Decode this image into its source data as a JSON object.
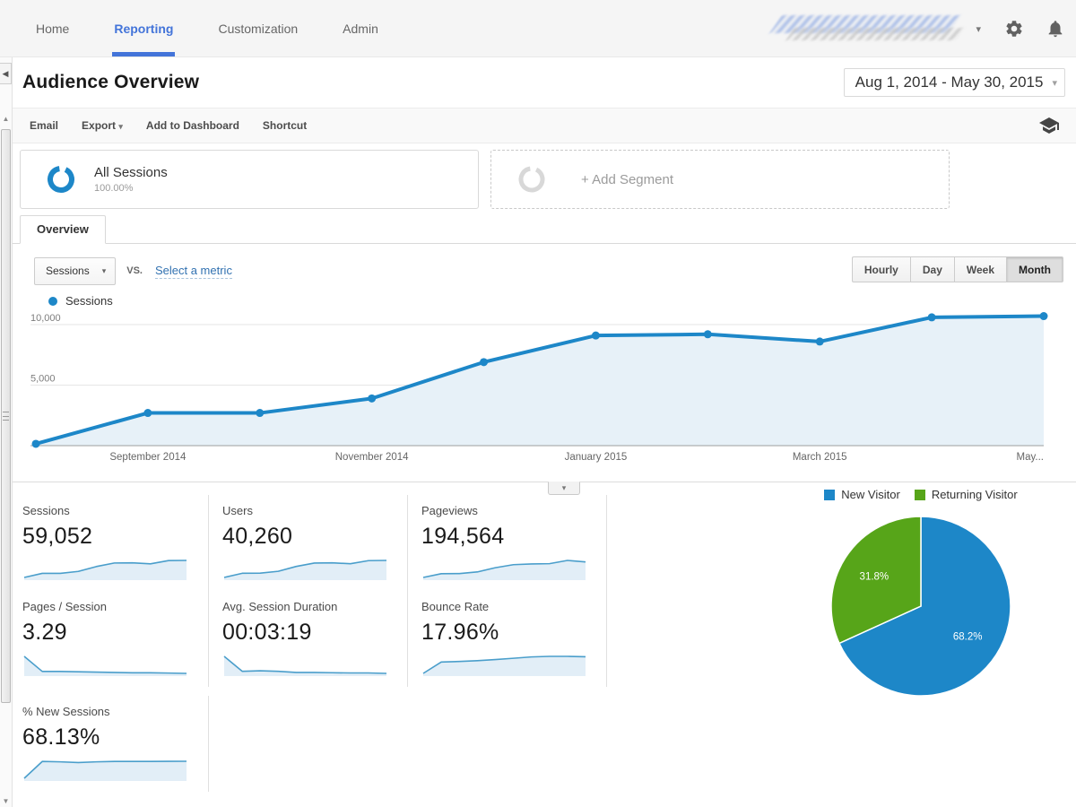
{
  "nav": {
    "items": [
      {
        "label": "Home"
      },
      {
        "label": "Reporting",
        "active": true
      },
      {
        "label": "Customization"
      },
      {
        "label": "Admin"
      }
    ]
  },
  "header": {
    "title": "Audience Overview",
    "date_range": "Aug 1, 2014 - May 30, 2015"
  },
  "toolbar": {
    "email": "Email",
    "export": "Export",
    "add_to_dashboard": "Add to Dashboard",
    "shortcut": "Shortcut"
  },
  "segments": {
    "all_sessions": {
      "label": "All Sessions",
      "percent": "100.00%"
    },
    "add_segment": "+ Add Segment"
  },
  "tabs": {
    "overview": "Overview"
  },
  "controls": {
    "metric_dropdown": "Sessions",
    "vs": "VS.",
    "select_metric": "Select a metric",
    "granularity": [
      "Hourly",
      "Day",
      "Week",
      "Month"
    ],
    "granularity_active": "Month"
  },
  "colors": {
    "line_blue": "#1d87c8",
    "area_fill": "#e7f1f8",
    "spark_line": "#4a9ecb",
    "spark_fill": "#e2eef7",
    "pie_blue": "#1d87c8",
    "pie_green": "#57a519",
    "grid": "#e6e6e6",
    "axis": "#9e9e9e"
  },
  "chart_data": [
    {
      "type": "line",
      "series": [
        {
          "name": "Sessions",
          "values": [
            150,
            2700,
            2700,
            3900,
            6900,
            9100,
            9200,
            8600,
            10600,
            10700
          ]
        }
      ],
      "x": [
        "Aug 2014",
        "Sep 2014",
        "Oct 2014",
        "Nov 2014",
        "Dec 2014",
        "Jan 2015",
        "Feb 2015",
        "Mar 2015",
        "Apr 2015",
        "May 2015"
      ],
      "ylim": [
        0,
        11000
      ],
      "yticks": [
        {
          "v": 5000,
          "label": "5,000"
        },
        {
          "v": 10000,
          "label": "10,000"
        }
      ],
      "xticks": [
        {
          "i": 1,
          "label": "September 2014"
        },
        {
          "i": 3,
          "label": "November 2014"
        },
        {
          "i": 5,
          "label": "January 2015"
        },
        {
          "i": 7,
          "label": "March 2015"
        },
        {
          "i": 9,
          "label": "May...",
          "anchor": "end"
        }
      ],
      "legend": [
        "Sessions"
      ],
      "grid": true
    },
    {
      "type": "pie",
      "slices": [
        {
          "label": "New Visitor",
          "value": 68.2,
          "pct_label": "68.2%",
          "color": "#1d87c8"
        },
        {
          "label": "Returning Visitor",
          "value": 31.8,
          "pct_label": "31.8%",
          "color": "#57a519"
        }
      ],
      "legend_position": "top"
    }
  ],
  "metrics": [
    {
      "label": "Sessions",
      "value": "59,052",
      "spark": [
        150,
        2700,
        2700,
        3900,
        6900,
        9100,
        9200,
        8600,
        10600,
        10700
      ]
    },
    {
      "label": "Users",
      "value": "40,260",
      "spark": [
        120,
        2000,
        2050,
        2900,
        5100,
        6600,
        6700,
        6300,
        7700,
        7800
      ]
    },
    {
      "label": "Pageviews",
      "value": "194,564",
      "spark": [
        500,
        8000,
        8300,
        11500,
        20000,
        26000,
        27500,
        28000,
        34500,
        31500
      ]
    },
    {
      "label": "Pages / Session",
      "value": "3.29",
      "spark": [
        5.6,
        3.3,
        3.3,
        3.25,
        3.2,
        3.15,
        3.1,
        3.1,
        3.05,
        3.0
      ]
    },
    {
      "label": "Avg. Session Duration",
      "value": "00:03:19",
      "spark": [
        340,
        205,
        210,
        205,
        195,
        195,
        192,
        190,
        190,
        186
      ]
    },
    {
      "label": "Bounce Rate",
      "value": "17.96%",
      "spark": [
        9.5,
        15.5,
        15.8,
        16.2,
        16.8,
        17.5,
        18.2,
        18.5,
        18.5,
        18.3
      ]
    },
    {
      "label": "% New Sessions",
      "value": "68.13%",
      "spark": [
        45,
        69,
        68.5,
        67.5,
        68.5,
        69,
        69,
        69,
        69.2,
        69.3
      ]
    }
  ]
}
